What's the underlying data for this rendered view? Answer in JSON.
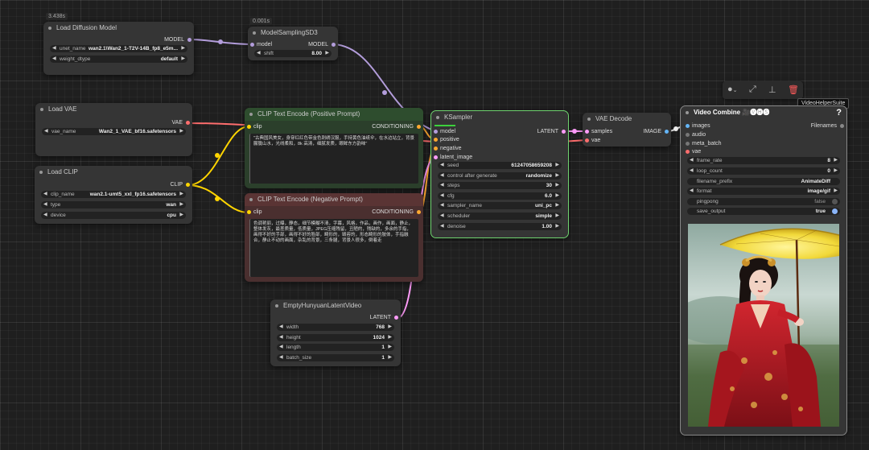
{
  "nodes": {
    "load_diffusion": {
      "timing": "3.438s",
      "title": "Load Diffusion Model",
      "output": "MODEL",
      "widgets": [
        {
          "label": "unet_name",
          "value": "wan2.1\\Wan2_1-T2V-14B_fp8_e5m..."
        },
        {
          "label": "weight_dtype",
          "value": "default"
        }
      ]
    },
    "model_sampling": {
      "timing": "0.001s",
      "title": "ModelSamplingSD3",
      "input": "model",
      "output": "MODEL",
      "widgets": [
        {
          "label": "shift",
          "value": "8.00"
        }
      ]
    },
    "load_vae": {
      "title": "Load VAE",
      "output": "VAE",
      "widgets": [
        {
          "label": "vae_name",
          "value": "Wan2_1_VAE_bf16.safetensors"
        }
      ]
    },
    "load_clip": {
      "title": "Load CLIP",
      "output": "CLIP",
      "widgets": [
        {
          "label": "clip_name",
          "value": "wan2.1-umt5_xxl_fp16.safetensors"
        },
        {
          "label": "type",
          "value": "wan"
        },
        {
          "label": "device",
          "value": "cpu"
        }
      ]
    },
    "clip_pos": {
      "title": "CLIP Text Encode (Positive Prompt)",
      "input": "clip",
      "output": "CONDITIONING",
      "text": "\"古典国风美女，身穿红红色带金色刺绣汉服，手持黄色油纸伞，在水边站立，背景朦胧山水，光线柔和，8k 高清，细腻发质，眼眸东方韵味\""
    },
    "clip_neg": {
      "title": "CLIP Text Encode (Negative Prompt)",
      "input": "clip",
      "output": "CONDITIONING",
      "text": "色调艳丽，过曝，静态，细节模糊不清，字幕，风格，作品，画作，画面，静止，整体发灰，最差质量，低质量，JPEG压缩残留，丑陋的，残缺的，多余的手指，画得不好的手部，画得不好的脸部，畸形的，毁容的，形态畸形的肢体，手指融合，静止不动的画面，杂乱的背景，三条腿，背景人很多，倒着走"
    },
    "ksampler": {
      "title": "KSampler",
      "inputs": [
        "model",
        "positive",
        "negative",
        "latent_image"
      ],
      "output": "LATENT",
      "widgets": [
        {
          "label": "seed",
          "value": "61247058659208"
        },
        {
          "label": "control after generate",
          "value": "randomize"
        },
        {
          "label": "steps",
          "value": "30"
        },
        {
          "label": "cfg",
          "value": "6.0"
        },
        {
          "label": "sampler_name",
          "value": "uni_pc"
        },
        {
          "label": "scheduler",
          "value": "simple"
        },
        {
          "label": "denoise",
          "value": "1.00"
        }
      ]
    },
    "vae_decode": {
      "title": "VAE Decode",
      "inputs": [
        "samples",
        "vae"
      ],
      "output": "IMAGE"
    },
    "empty_latent": {
      "title": "EmptyHunyuanLatentVideo",
      "output": "LATENT",
      "widgets": [
        {
          "label": "width",
          "value": "768"
        },
        {
          "label": "height",
          "value": "1024"
        },
        {
          "label": "length",
          "value": "1"
        },
        {
          "label": "batch_size",
          "value": "1"
        }
      ]
    },
    "video_combine": {
      "title": "Video Combine",
      "title_icons": "🎥🅥🅗🅢",
      "help": "?",
      "inputs": [
        "images",
        "audio",
        "meta_batch",
        "vae"
      ],
      "output": "Filenames",
      "widgets": [
        {
          "label": "frame_rate",
          "value": "8"
        },
        {
          "label": "loop_count",
          "value": "0"
        },
        {
          "label": "filename_prefix",
          "value": "AnimateDiff"
        },
        {
          "label": "format",
          "value": "image/gif"
        },
        {
          "label": "pingpong",
          "value": "false"
        },
        {
          "label": "save_output",
          "value": "true"
        }
      ]
    }
  },
  "toolbar": {
    "tooltip": "VideoHelperSuite",
    "icons": [
      "color-circle-icon",
      "bypass-icon",
      "pin-icon",
      "trash-icon"
    ]
  },
  "colors": {
    "model_wire": "#b39ddb",
    "clip_wire": "#ffd500",
    "vae_wire": "#ff6e6e",
    "cond_wire": "#ffa931",
    "latent_wire": "#ff9cf9",
    "image_wire": "#64b5f6",
    "selected": "#6fd36f"
  }
}
